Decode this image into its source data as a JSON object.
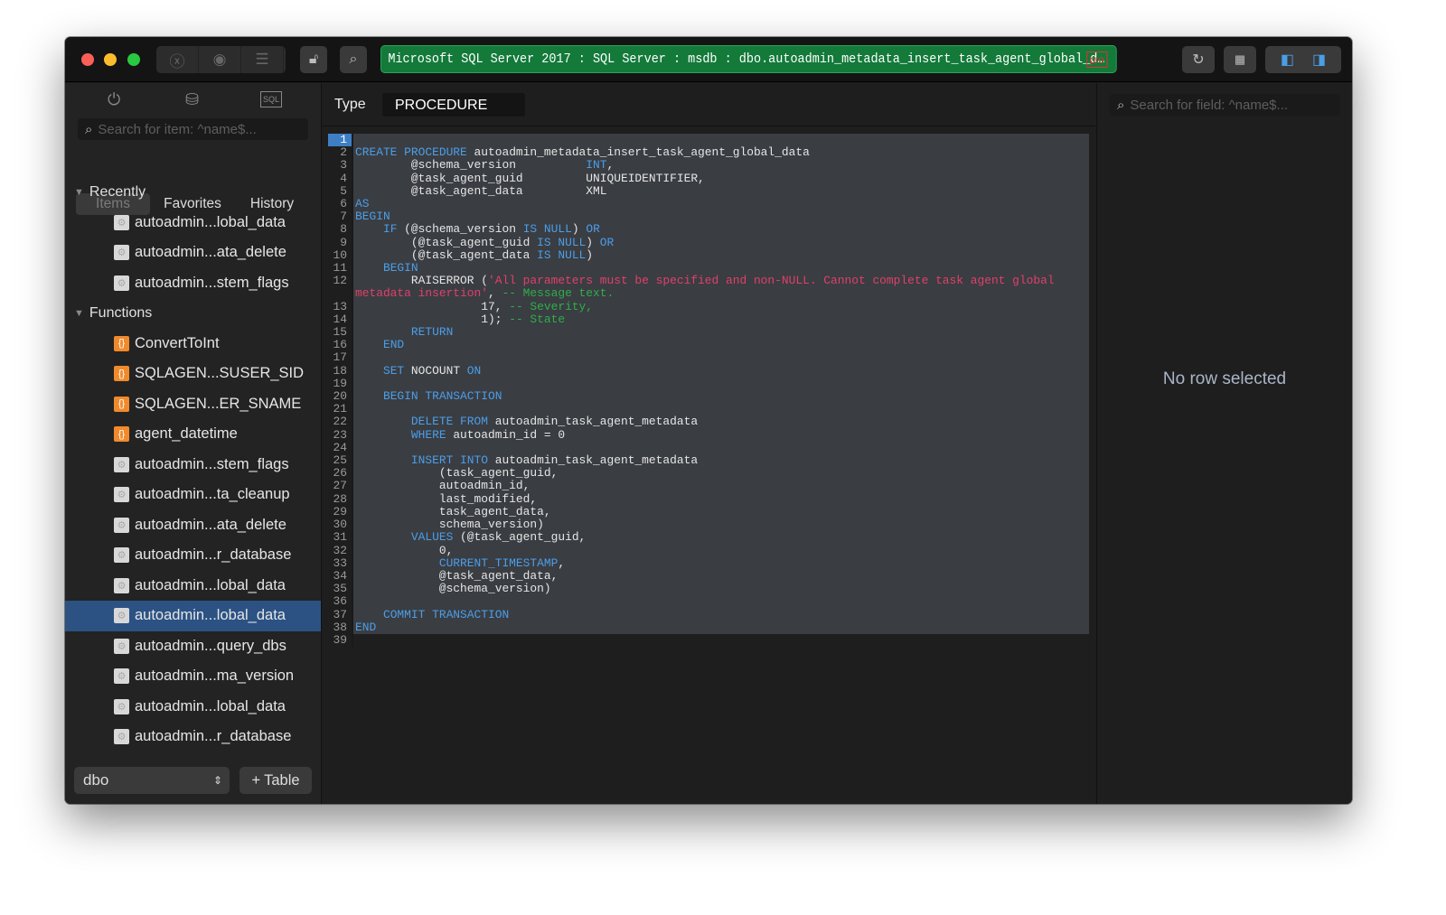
{
  "toolbar": {
    "connection": "Microsoft SQL Server 2017 : SQL Server  : msdb : dbo.autoadmin_metadata_insert_task_agent_global_d…",
    "badge": "pro"
  },
  "sidebar": {
    "search_placeholder": "Search for item: ^name$...",
    "tabs": [
      "Items",
      "Favorites",
      "History"
    ],
    "sections": [
      {
        "label": "Recently",
        "items": [
          {
            "label": "autoadmin...lobal_data",
            "icon": "procedure-icon"
          },
          {
            "label": "autoadmin...ata_delete",
            "icon": "procedure-icon"
          },
          {
            "label": "autoadmin...stem_flags",
            "icon": "procedure-icon"
          }
        ]
      },
      {
        "label": "Functions",
        "items": [
          {
            "label": "ConvertToInt",
            "icon": "function-icon"
          },
          {
            "label": "SQLAGEN...SUSER_SID",
            "icon": "function-icon"
          },
          {
            "label": "SQLAGEN...ER_SNAME",
            "icon": "function-icon"
          },
          {
            "label": "agent_datetime",
            "icon": "function-icon"
          },
          {
            "label": "autoadmin...stem_flags",
            "icon": "procedure-icon"
          },
          {
            "label": "autoadmin...ta_cleanup",
            "icon": "procedure-icon"
          },
          {
            "label": "autoadmin...ata_delete",
            "icon": "procedure-icon"
          },
          {
            "label": "autoadmin...r_database",
            "icon": "procedure-icon"
          },
          {
            "label": "autoadmin...lobal_data",
            "icon": "procedure-icon"
          },
          {
            "label": "autoadmin...lobal_data",
            "icon": "procedure-icon",
            "selected": true
          },
          {
            "label": "autoadmin...query_dbs",
            "icon": "procedure-icon"
          },
          {
            "label": "autoadmin...ma_version",
            "icon": "procedure-icon"
          },
          {
            "label": "autoadmin...lobal_data",
            "icon": "procedure-icon"
          },
          {
            "label": "autoadmin...r_database",
            "icon": "procedure-icon"
          }
        ]
      }
    ],
    "schema": "dbo",
    "add_table": "Table"
  },
  "main": {
    "type_label": "Type",
    "type_value": "PROCEDURE",
    "code": [
      [],
      [
        [
          "kw",
          "CREATE PROCEDURE"
        ],
        [
          "t",
          " autoadmin_metadata_insert_task_agent_global_data"
        ]
      ],
      [
        [
          "t",
          "        @schema_version          "
        ],
        [
          "kw",
          "INT"
        ],
        [
          "t",
          ","
        ]
      ],
      [
        [
          "t",
          "        @task_agent_guid         UNIQUEIDENTIFIER,"
        ]
      ],
      [
        [
          "t",
          "        @task_agent_data         XML"
        ]
      ],
      [
        [
          "kw",
          "AS"
        ]
      ],
      [
        [
          "kw",
          "BEGIN"
        ]
      ],
      [
        [
          "t",
          "    "
        ],
        [
          "kw",
          "IF"
        ],
        [
          "t",
          " (@schema_version "
        ],
        [
          "kw",
          "IS NULL"
        ],
        [
          "t",
          ") "
        ],
        [
          "kw",
          "OR"
        ]
      ],
      [
        [
          "t",
          "        (@task_agent_guid "
        ],
        [
          "kw",
          "IS NULL"
        ],
        [
          "t",
          ") "
        ],
        [
          "kw",
          "OR"
        ]
      ],
      [
        [
          "t",
          "        (@task_agent_data "
        ],
        [
          "kw",
          "IS NULL"
        ],
        [
          "t",
          ")"
        ]
      ],
      [
        [
          "t",
          "    "
        ],
        [
          "kw",
          "BEGIN"
        ]
      ],
      [
        [
          "t",
          "        RAISERROR ("
        ],
        [
          "str",
          "'All parameters must be specified and non-NULL. Cannot complete task agent global metadata insertion'"
        ],
        [
          "t",
          ", "
        ],
        [
          "cmt",
          "-- Message text."
        ]
      ],
      [
        [
          "t",
          "                  17, "
        ],
        [
          "cmt",
          "-- Severity,"
        ]
      ],
      [
        [
          "t",
          "                  1); "
        ],
        [
          "cmt",
          "-- State"
        ]
      ],
      [
        [
          "t",
          "        "
        ],
        [
          "kw",
          "RETURN"
        ]
      ],
      [
        [
          "t",
          "    "
        ],
        [
          "kw",
          "END"
        ]
      ],
      [],
      [
        [
          "t",
          "    "
        ],
        [
          "kw",
          "SET"
        ],
        [
          "t",
          " NOCOUNT "
        ],
        [
          "kw",
          "ON"
        ]
      ],
      [],
      [
        [
          "t",
          "    "
        ],
        [
          "kw",
          "BEGIN TRANSACTION"
        ]
      ],
      [],
      [
        [
          "t",
          "        "
        ],
        [
          "kw",
          "DELETE FROM"
        ],
        [
          "t",
          " autoadmin_task_agent_metadata"
        ]
      ],
      [
        [
          "t",
          "        "
        ],
        [
          "kw",
          "WHERE"
        ],
        [
          "t",
          " autoadmin_id = 0"
        ]
      ],
      [],
      [
        [
          "t",
          "        "
        ],
        [
          "kw",
          "INSERT INTO"
        ],
        [
          "t",
          " autoadmin_task_agent_metadata"
        ]
      ],
      [
        [
          "t",
          "            (task_agent_guid,"
        ]
      ],
      [
        [
          "t",
          "            autoadmin_id,"
        ]
      ],
      [
        [
          "t",
          "            last_modified,"
        ]
      ],
      [
        [
          "t",
          "            task_agent_data,"
        ]
      ],
      [
        [
          "t",
          "            schema_version)"
        ]
      ],
      [
        [
          "t",
          "        "
        ],
        [
          "kw",
          "VALUES"
        ],
        [
          "t",
          " (@task_agent_guid,"
        ]
      ],
      [
        [
          "t",
          "            0,"
        ]
      ],
      [
        [
          "t",
          "            "
        ],
        [
          "kw",
          "CURRENT_TIMESTAMP"
        ],
        [
          "t",
          ","
        ]
      ],
      [
        [
          "t",
          "            @task_agent_data,"
        ]
      ],
      [
        [
          "t",
          "            @schema_version)"
        ]
      ],
      [],
      [
        [
          "t",
          "    "
        ],
        [
          "kw",
          "COMMIT TRANSACTION"
        ]
      ],
      [
        [
          "kw",
          "END"
        ]
      ],
      null
    ]
  },
  "right": {
    "search_placeholder": "Search for field: ^name$...",
    "empty": "No row selected"
  }
}
